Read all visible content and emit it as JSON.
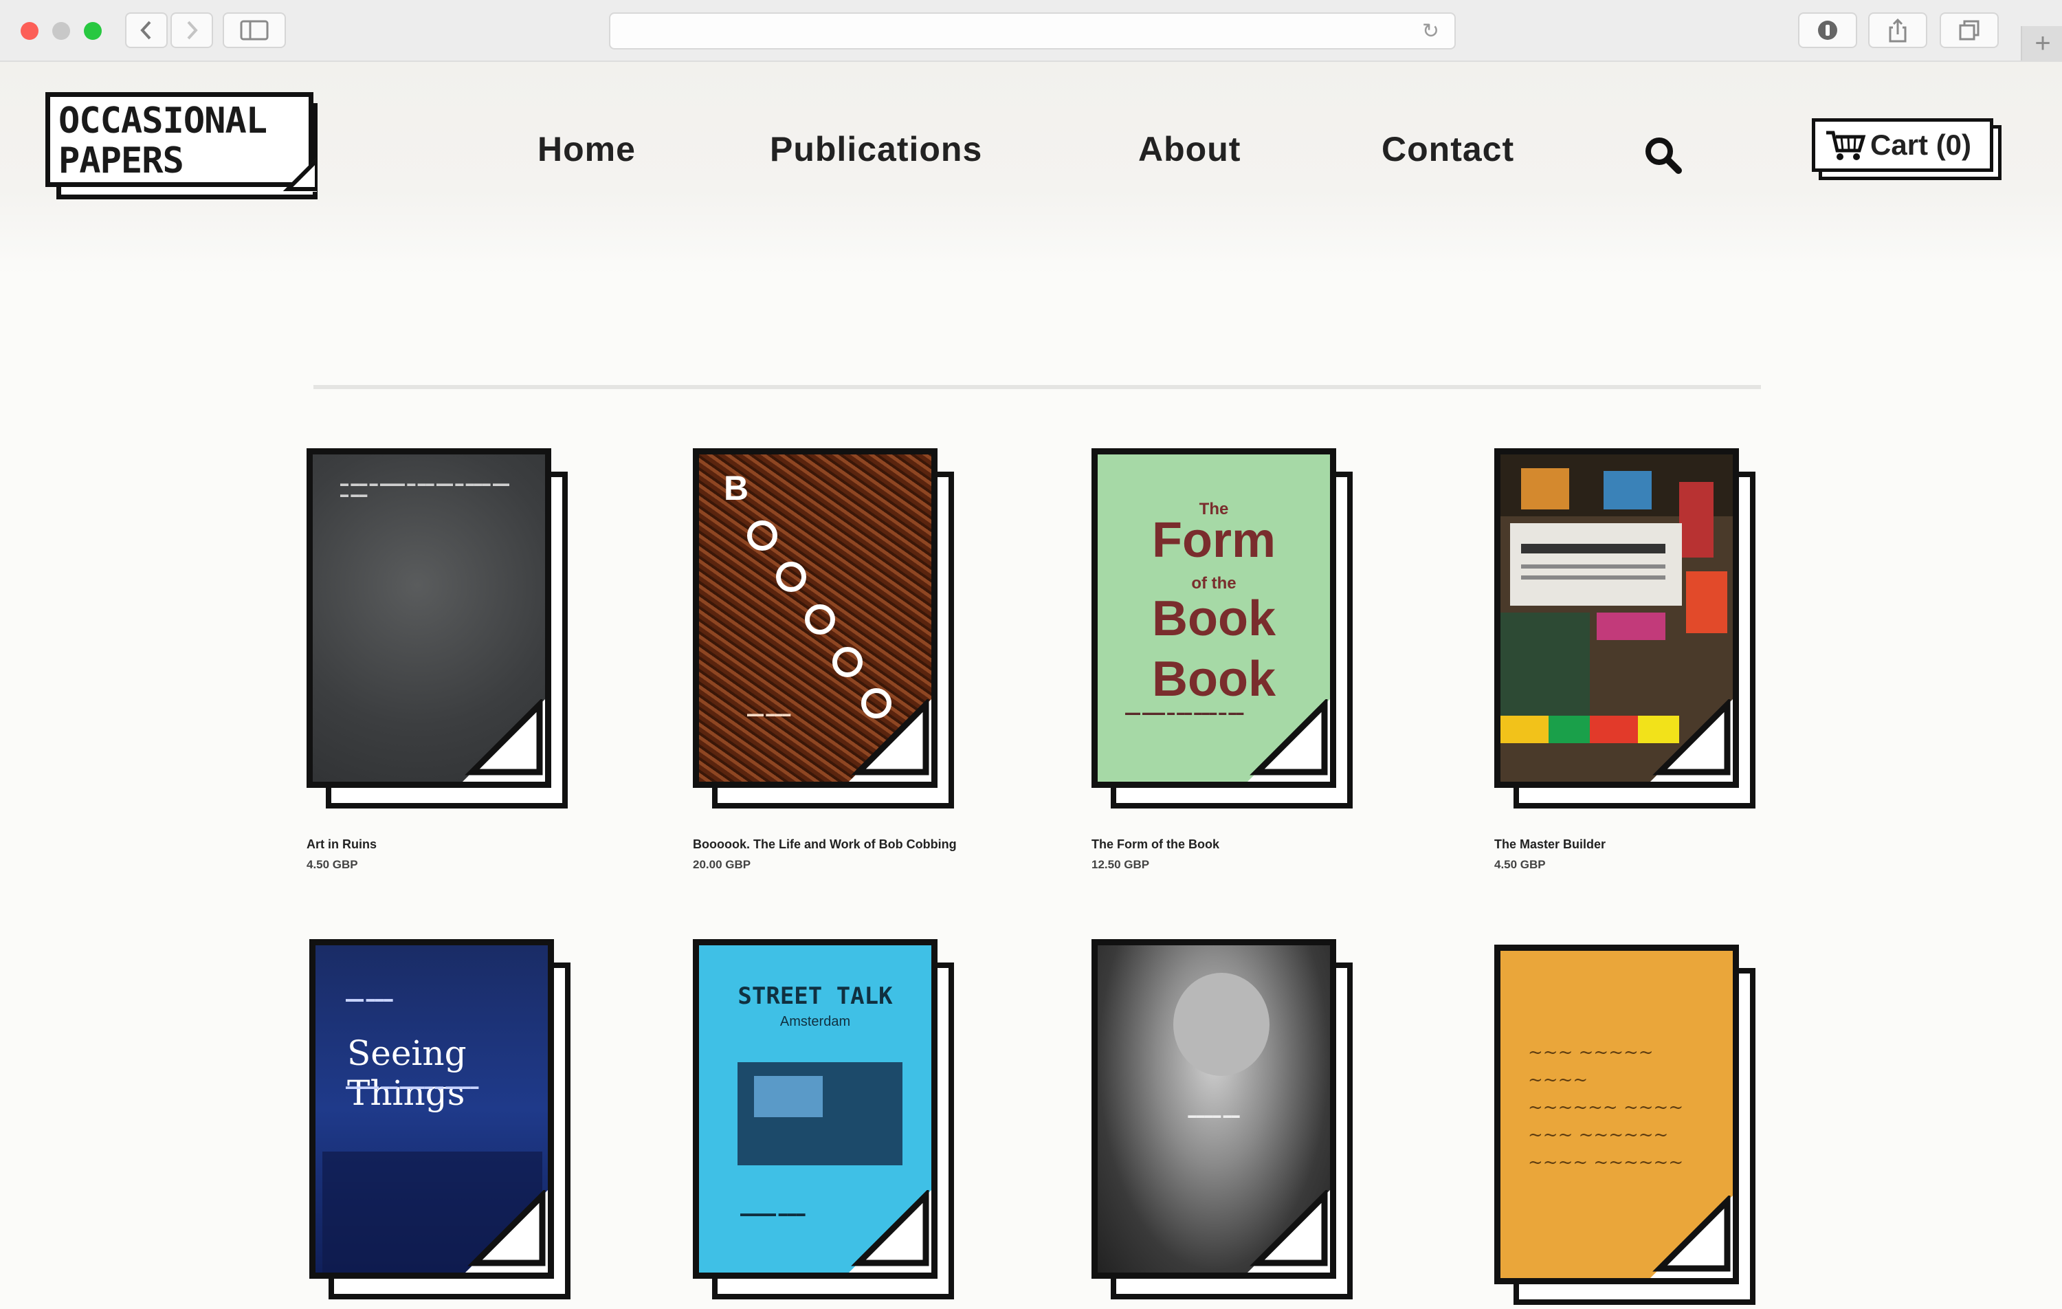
{
  "browser": {
    "address_url": "",
    "new_tab_symbol": "+"
  },
  "site": {
    "logo_lines": [
      "OCCASIONAL",
      "PAPERS"
    ],
    "nav": {
      "home": "Home",
      "publications": "Publications",
      "about": "About",
      "contact": "Contact"
    },
    "cart_label": "Cart (0)"
  },
  "products": [
    {
      "title": "Art in Ruins",
      "price": "4.50 GBP"
    },
    {
      "title": "Boooook. The Life and Work of Bob Cobbing",
      "price": "20.00 GBP"
    },
    {
      "title": "The Form of the Book",
      "price": "12.50 GBP"
    },
    {
      "title": "The Master Builder",
      "price": "4.50 GBP"
    },
    {
      "title": "",
      "price": ""
    },
    {
      "title": "",
      "price": ""
    },
    {
      "title": "",
      "price": ""
    },
    {
      "title": "",
      "price": ""
    }
  ],
  "covers": {
    "bob_letter": "B",
    "form": {
      "the": "The",
      "form": "Form",
      "of_the": "of the",
      "book1": "Book",
      "book2": "Book"
    },
    "seeing": "Seeing Things",
    "street": {
      "title": "STREET TALK",
      "sub": "Amsterdam"
    }
  },
  "colors": {
    "form_cover": "#a6d9a6",
    "street_cover": "#3fc0e6",
    "orange_cover": "#eaa63a",
    "seeing_cover": "#1f3a8a"
  }
}
